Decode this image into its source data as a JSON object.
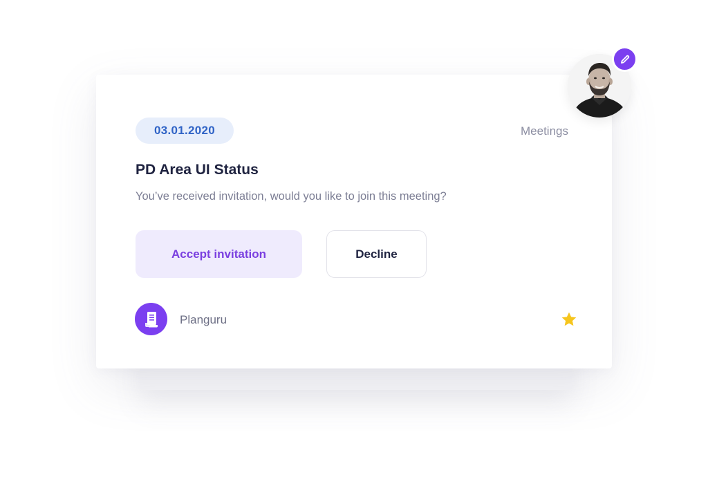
{
  "invitation": {
    "date": "03.01.2020",
    "category": "Meetings",
    "title": "PD Area UI Status",
    "message": "You’ve received invitation, would you like to join this meeting?",
    "accept_label": "Accept invitation",
    "decline_label": "Decline"
  },
  "footer": {
    "app_name": "Planguru",
    "app_icon": "document-icon",
    "favorite_icon": "star-icon"
  },
  "profile": {
    "avatar_icon": "avatar",
    "edit_icon": "pencil-icon"
  },
  "colors": {
    "accent": "#7b3ff0",
    "date_bg": "#e7eefb",
    "date_text": "#2f63c6",
    "star": "#f6c51d",
    "title": "#1f2340"
  }
}
